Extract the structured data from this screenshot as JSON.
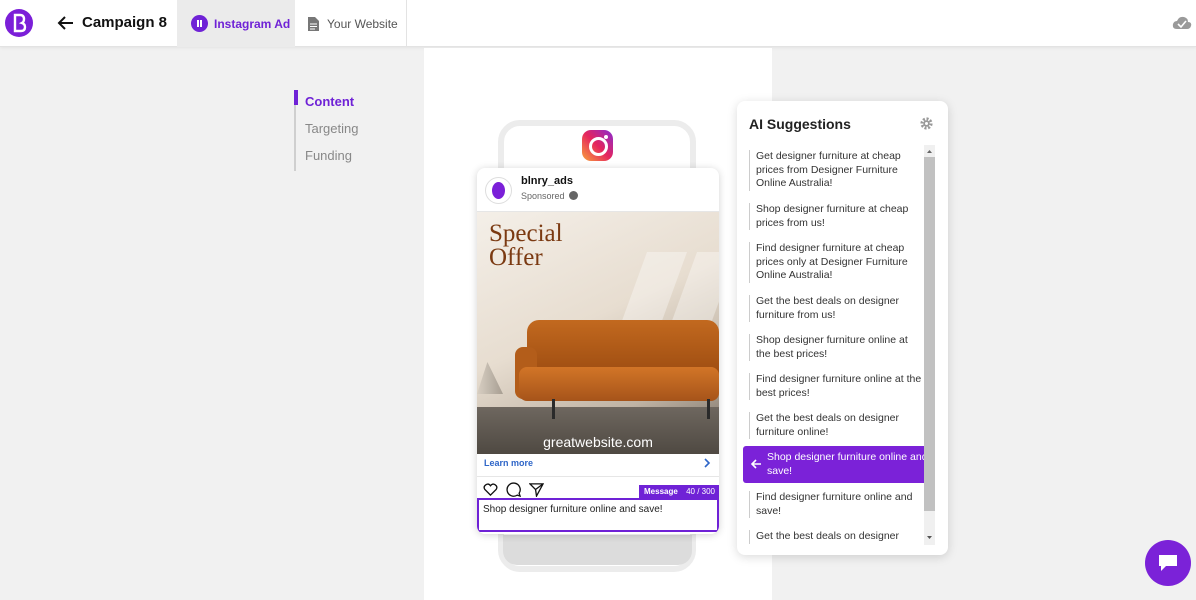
{
  "header": {
    "campaign_title": "Campaign 8",
    "tabs": [
      {
        "label": "Instagram Ad",
        "active": true
      },
      {
        "label": "Your Website",
        "active": false
      }
    ]
  },
  "sidenav": {
    "items": [
      {
        "label": "Content",
        "active": true
      },
      {
        "label": "Targeting",
        "active": false
      },
      {
        "label": "Funding",
        "active": false
      }
    ]
  },
  "ad": {
    "handle": "blnry_ads",
    "sponsored": "Sponsored",
    "image_headline": "Special\nOffer",
    "image_caption": "greatwebsite.com",
    "cta": "Learn more",
    "message_label": "Message",
    "message_count": "40 / 300",
    "message_text": "Shop designer furniture online and save!"
  },
  "ai_panel": {
    "title": "AI Suggestions",
    "suggestions": [
      "Get designer furniture at cheap prices from Designer Furniture Online Australia!",
      "Shop designer furniture at cheap prices from us!",
      "Find designer furniture at cheap prices only at Designer Furniture Online Australia!",
      "Get the best deals on designer furniture from us!",
      "Shop designer furniture online at the best prices!",
      "Find designer furniture online at the best prices!",
      "Get the best deals on designer furniture online!",
      "Shop designer furniture online and save!",
      "Find designer furniture online and save!",
      "Get the best deals on designer"
    ],
    "selected_index": 7
  },
  "colors": {
    "accent": "#6f22d6",
    "link": "#2f66c8"
  }
}
